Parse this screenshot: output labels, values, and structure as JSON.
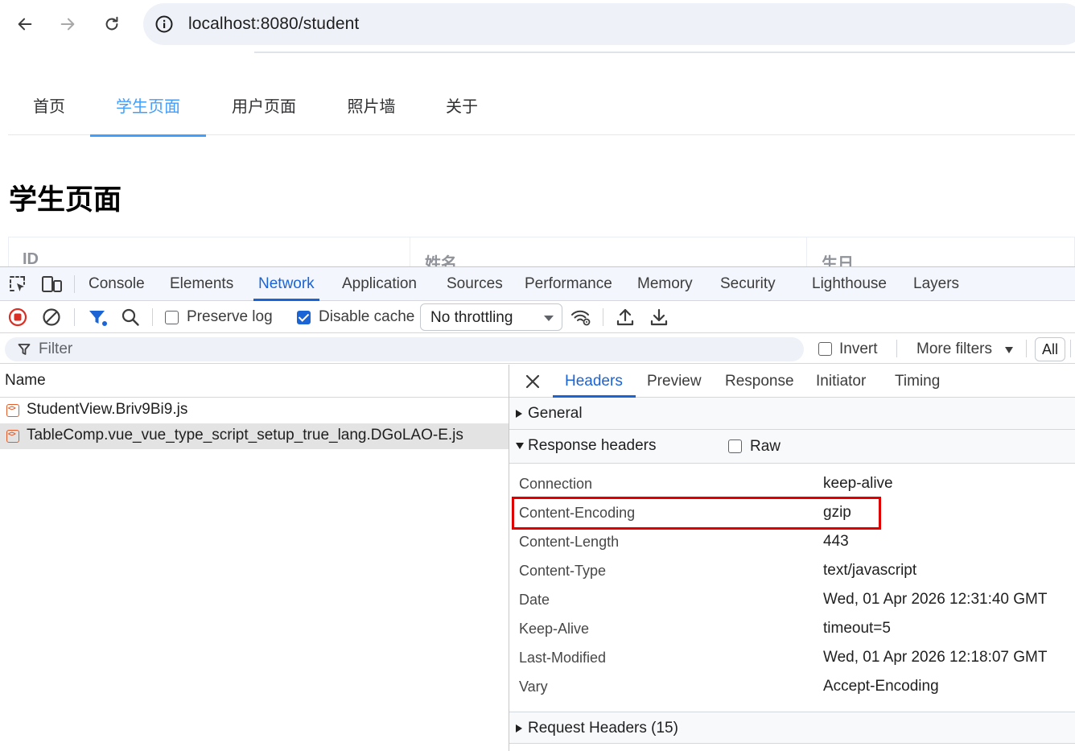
{
  "browser": {
    "url": "localhost:8080/student"
  },
  "page": {
    "tabs": [
      "首页",
      "学生页面",
      "用户页面",
      "照片墙",
      "关于"
    ],
    "active_tab": "学生页面",
    "title": "学生页面",
    "table_headers": [
      "ID",
      "姓名",
      "生日"
    ]
  },
  "devtools": {
    "tabs": [
      "Console",
      "Elements",
      "Network",
      "Application",
      "Sources",
      "Performance",
      "Memory",
      "Security",
      "Lighthouse",
      "Layers"
    ],
    "active_tab": "Network",
    "toolbar": {
      "preserve_log_label": "Preserve log",
      "preserve_log_checked": false,
      "disable_cache_label": "Disable cache",
      "disable_cache_checked": true,
      "throttling_value": "No throttling"
    },
    "filterbar": {
      "filter_placeholder": "Filter",
      "invert_label": "Invert",
      "invert_checked": false,
      "more_filters_label": "More filters",
      "all_label": "All"
    },
    "requests": {
      "column_name": "Name",
      "items": [
        {
          "name": "StudentView.Briv9Bi9.js",
          "selected": false
        },
        {
          "name": "TableComp.vue_vue_type_script_setup_true_lang.DGoLAO-E.js",
          "selected": true
        }
      ]
    },
    "detail": {
      "tabs": [
        "Headers",
        "Preview",
        "Response",
        "Initiator",
        "Timing"
      ],
      "active_tab": "Headers",
      "general_label": "General",
      "response_headers_label": "Response headers",
      "raw_label": "Raw",
      "raw_checked": false,
      "response_headers": [
        {
          "name": "Connection",
          "value": "keep-alive"
        },
        {
          "name": "Content-Encoding",
          "value": "gzip",
          "highlighted": true
        },
        {
          "name": "Content-Length",
          "value": "443"
        },
        {
          "name": "Content-Type",
          "value": "text/javascript"
        },
        {
          "name": "Date",
          "value": "Wed, 01 Apr 2026 12:31:40 GMT"
        },
        {
          "name": "Keep-Alive",
          "value": "timeout=5"
        },
        {
          "name": "Last-Modified",
          "value": "Wed, 01 Apr 2026 12:18:07 GMT"
        },
        {
          "name": "Vary",
          "value": "Accept-Encoding"
        }
      ],
      "request_headers_label": "Request Headers (15)"
    },
    "colors": {
      "accent": "#1a64d6",
      "page_accent": "#409eff",
      "highlight": "#e00000"
    }
  }
}
